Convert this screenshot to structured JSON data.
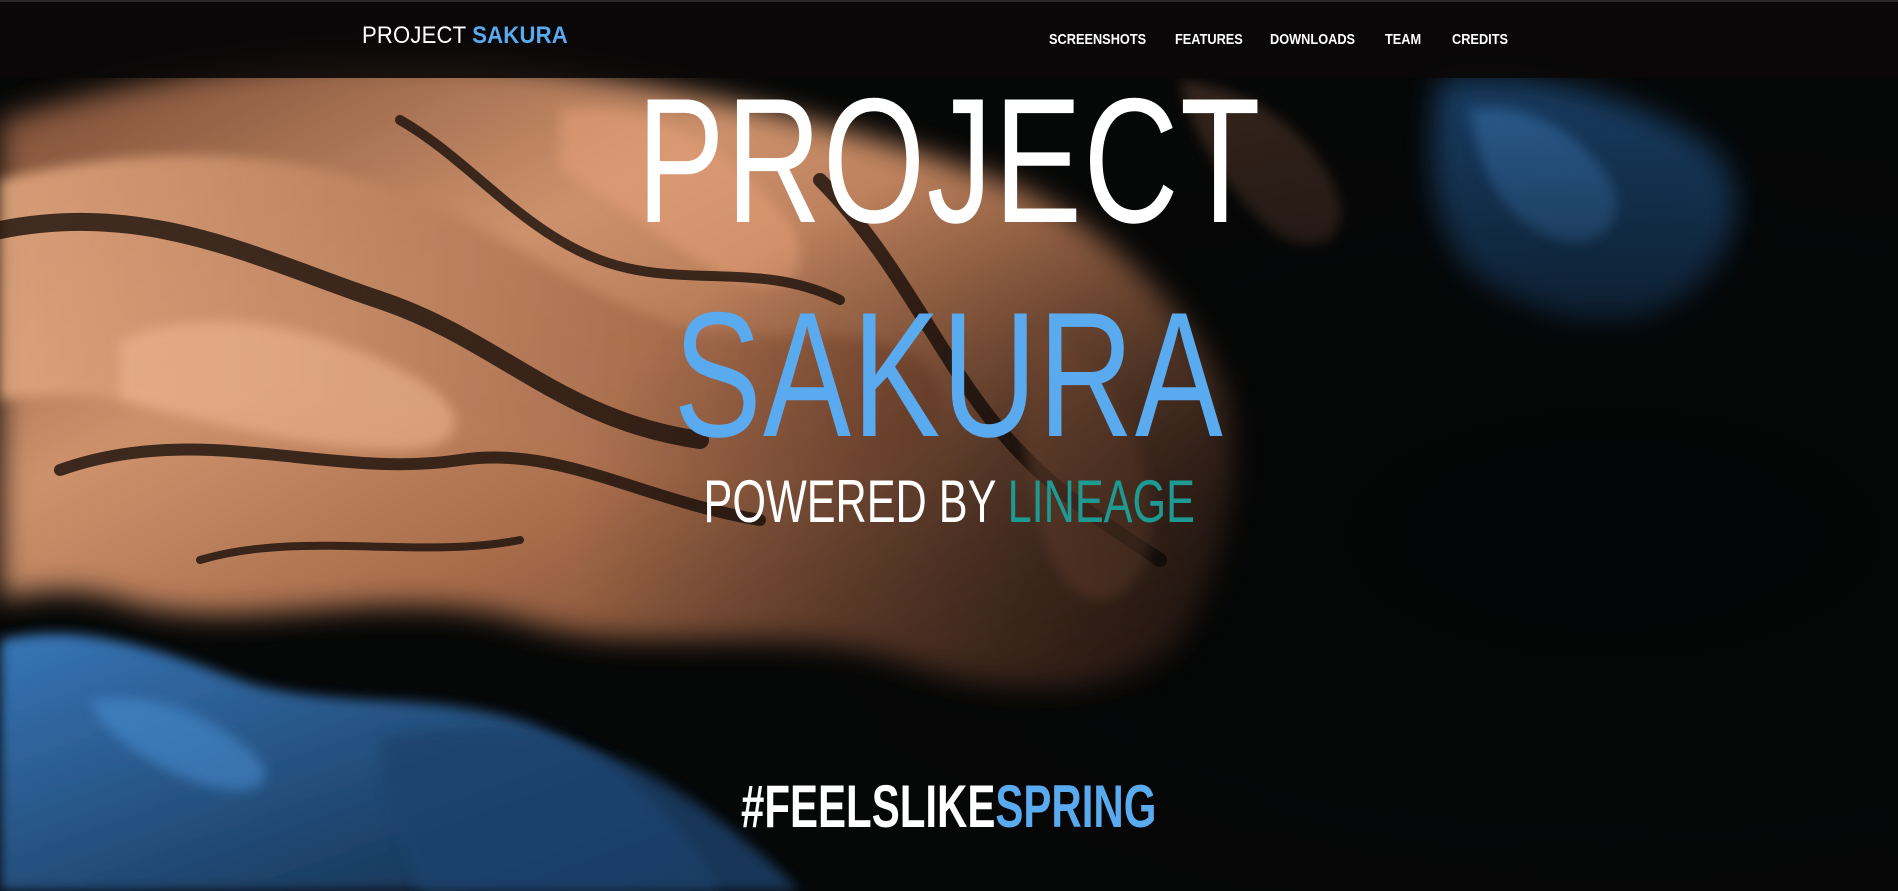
{
  "navbar": {
    "brand": {
      "prefix": "PROJECT",
      "accent": "SAKURA"
    },
    "links": [
      {
        "label": "SCREENSHOTS"
      },
      {
        "label": "FEATURES"
      },
      {
        "label": "DOWNLOADS"
      },
      {
        "label": "TEAM"
      },
      {
        "label": "CREDITS"
      }
    ]
  },
  "hero": {
    "title_line_1": "PROJECT",
    "title_line_2": "SAKURA",
    "subtitle_prefix": "POWERED BY",
    "subtitle_accent": "LINEAGE",
    "hashtag_prefix": "#FEELSLIKE",
    "hashtag_accent": "SPRING"
  },
  "colors": {
    "accent_blue": "#5aaaf0",
    "accent_teal": "#1d9a92",
    "navbar_bg": "#0a0808",
    "text_white": "#ffffff",
    "background_dark": "#050607",
    "fluid_copper": "#c2805a",
    "fluid_blue": "#2a5f9a"
  }
}
